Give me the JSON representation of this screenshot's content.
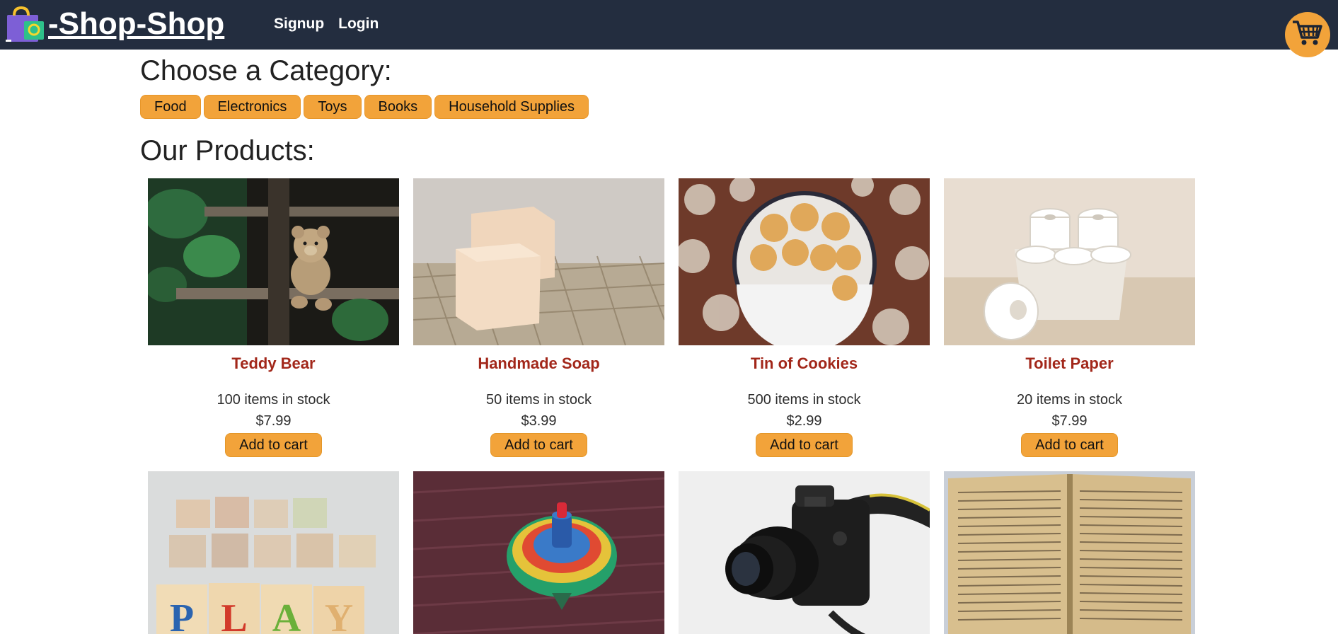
{
  "header": {
    "brand_text": "-Shop-Shop",
    "brand_icon": "shopping-bag-icon",
    "nav": [
      {
        "label": "Signup"
      },
      {
        "label": "Login"
      }
    ],
    "cart_icon": "shopping-cart-icon"
  },
  "categories": {
    "title": "Choose a Category:",
    "items": [
      {
        "label": "Food"
      },
      {
        "label": "Electronics"
      },
      {
        "label": "Toys"
      },
      {
        "label": "Books"
      },
      {
        "label": "Household Supplies"
      }
    ]
  },
  "products": {
    "title": "Our Products:",
    "add_label": "Add to cart",
    "items": [
      {
        "name": "Teddy Bear",
        "stock": "100 items in stock",
        "price": "$7.99",
        "image": "teddy-bear-photo"
      },
      {
        "name": "Handmade Soap",
        "stock": "50 items in stock",
        "price": "$3.99",
        "image": "soap-photo"
      },
      {
        "name": "Tin of Cookies",
        "stock": "500 items in stock",
        "price": "$2.99",
        "image": "cookies-photo"
      },
      {
        "name": "Toilet Paper",
        "stock": "20 items in stock",
        "price": "$7.99",
        "image": "toilet-paper-photo"
      },
      {
        "image": "alphabet-blocks-photo"
      },
      {
        "image": "spinning-top-photo"
      },
      {
        "image": "camera-photo"
      },
      {
        "image": "book-photo"
      }
    ]
  },
  "colors": {
    "header_bg": "#232d3f",
    "accent": "#f2a33a",
    "product_name": "#a2271a"
  }
}
